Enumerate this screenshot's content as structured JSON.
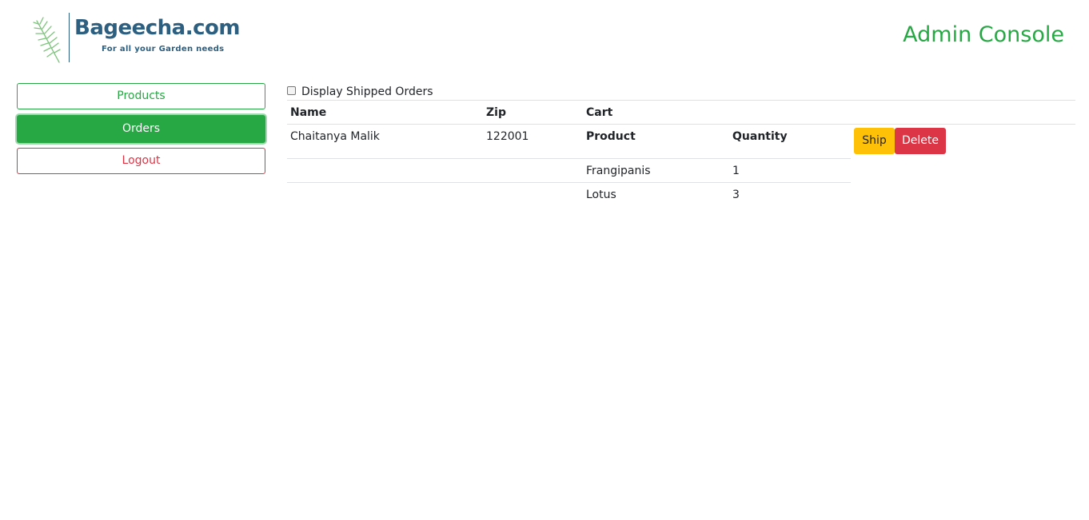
{
  "brand": {
    "name": "Bageecha.com",
    "tagline": "For all your Garden needs",
    "colors": {
      "primary": "#2c5f80",
      "leaf": "#7cc47c"
    },
    "icon": "palm-leaf-icon"
  },
  "header": {
    "title": "Admin Console",
    "title_color": "#28a745"
  },
  "sidebar": {
    "items": [
      {
        "label": "Products",
        "style": "outline-success"
      },
      {
        "label": "Orders",
        "style": "success",
        "active": true
      },
      {
        "label": "Logout",
        "style": "outline-danger"
      }
    ]
  },
  "orders": {
    "filter_label": "Display Shipped Orders",
    "filter_checked": false,
    "columns": [
      "Name",
      "Zip",
      "Cart"
    ],
    "cart_columns": [
      "Product",
      "Quantity"
    ],
    "rows": [
      {
        "name": "Chaitanya Malik",
        "zip": "122001",
        "cart": [
          {
            "product": "Frangipanis",
            "quantity": "1"
          },
          {
            "product": "Lotus",
            "quantity": "3"
          }
        ],
        "actions": {
          "ship_label": "Ship",
          "delete_label": "Delete"
        }
      }
    ]
  },
  "colors": {
    "success": "#28a745",
    "warning": "#ffc107",
    "danger": "#dc3545"
  }
}
